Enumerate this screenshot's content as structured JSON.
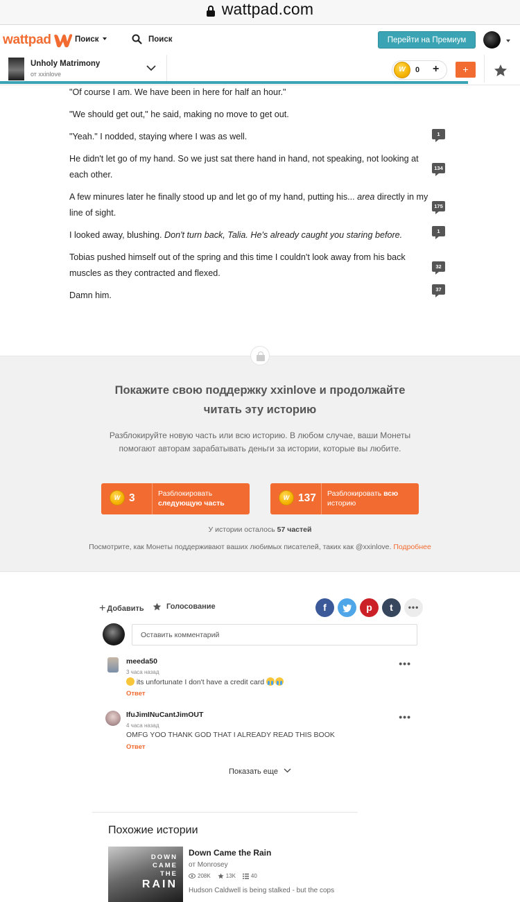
{
  "browser": {
    "url": "wattpad.com"
  },
  "nav": {
    "logo_text": "wattpad",
    "browse_label": "Поиск",
    "search_label": "Поиск",
    "premium_label": "Перейти на Премиум"
  },
  "story": {
    "title": "Unholy Matrimony",
    "author": "от xxinlove",
    "coins": "0",
    "add_label": "+",
    "progress_percent": 90
  },
  "reader": {
    "paragraphs": [
      {
        "text": "\"Of course I am. We have been in here for half an hour.\"",
        "comments": ""
      },
      {
        "text": "\"We should get out,\" he said, making no move to get out.",
        "comments": ""
      },
      {
        "text": "\"Yeah.\" I nodded, staying where I was as well.",
        "comments": "1"
      },
      {
        "text": "He didn't let go of my hand. So we just sat there hand in hand, not speaking, not looking at each other.",
        "comments": "134"
      },
      {
        "text_a": "A few minures later he finally stood up and let go of my hand, putting his... ",
        "text_b": "area",
        "text_c": " directly in my line of sight.",
        "comments": "175"
      },
      {
        "text_a": "I looked away, blushing. ",
        "text_b": "Don't turn back, Talia. He's already caught you staring before.",
        "comments": "1"
      },
      {
        "text": "Tobias pushed himself out of the spring and this time I couldn't look away from his back muscles as they contracted and flexed.",
        "comments": "32"
      },
      {
        "text": "Damn him.",
        "comments": "37"
      }
    ]
  },
  "paywall": {
    "title": "Покажите свою поддержку xxinlove и продолжайте читать эту историю",
    "description": "Разблокируйте новую часть или всю историю. В любом случае, ваши Монеты помогают авторам зарабатывать деньги за истории, которые вы любите.",
    "next_part": {
      "price": "3",
      "label_a": "Разблокировать",
      "label_b": "следующую часть"
    },
    "whole_story": {
      "price": "137",
      "label_a": "Разблокировать ",
      "label_b": "всю",
      "label_c": "историю"
    },
    "remaining_a": "У истории осталось ",
    "remaining_b": "57 частей",
    "note": "Посмотрите, как Монеты поддерживают ваших любимых писателей, таких как @xxinlove. ",
    "note_link": "Подробнее",
    "coin_symbol": "W"
  },
  "actions": {
    "add_label": "Добавить",
    "vote_label": "Голосование",
    "share": [
      "f",
      "t",
      "p",
      "t"
    ]
  },
  "comments": {
    "placeholder": "Оставить комментарий",
    "items": [
      {
        "user": "meeda50",
        "time": "3 часа назад",
        "text": " its unfortunate I don't have a credit card ",
        "reply": "Ответ"
      },
      {
        "user": "IfuJimINuCantJimOUT",
        "time": "4 часа назад",
        "text": "OMFG YOO THANK GOD THAT I ALREADY READ THIS BOOK",
        "reply": "Ответ"
      }
    ],
    "show_more": "Показать еще"
  },
  "similar": {
    "heading": "Похожие истории",
    "items": [
      {
        "cover_lines": [
          "DOWN",
          "CAME",
          "THE",
          "RAIN"
        ],
        "title": "Down Came the Rain",
        "author": "от Monrosey",
        "reads": "208K",
        "votes": "13K",
        "parts": "40",
        "description": "Hudson Caldwell is being stalked - but the cops"
      }
    ]
  },
  "colors": {
    "brand_orange": "#f26b30",
    "premium_teal": "#3ba4b4",
    "paywall_bg": "#f1f1f1"
  }
}
